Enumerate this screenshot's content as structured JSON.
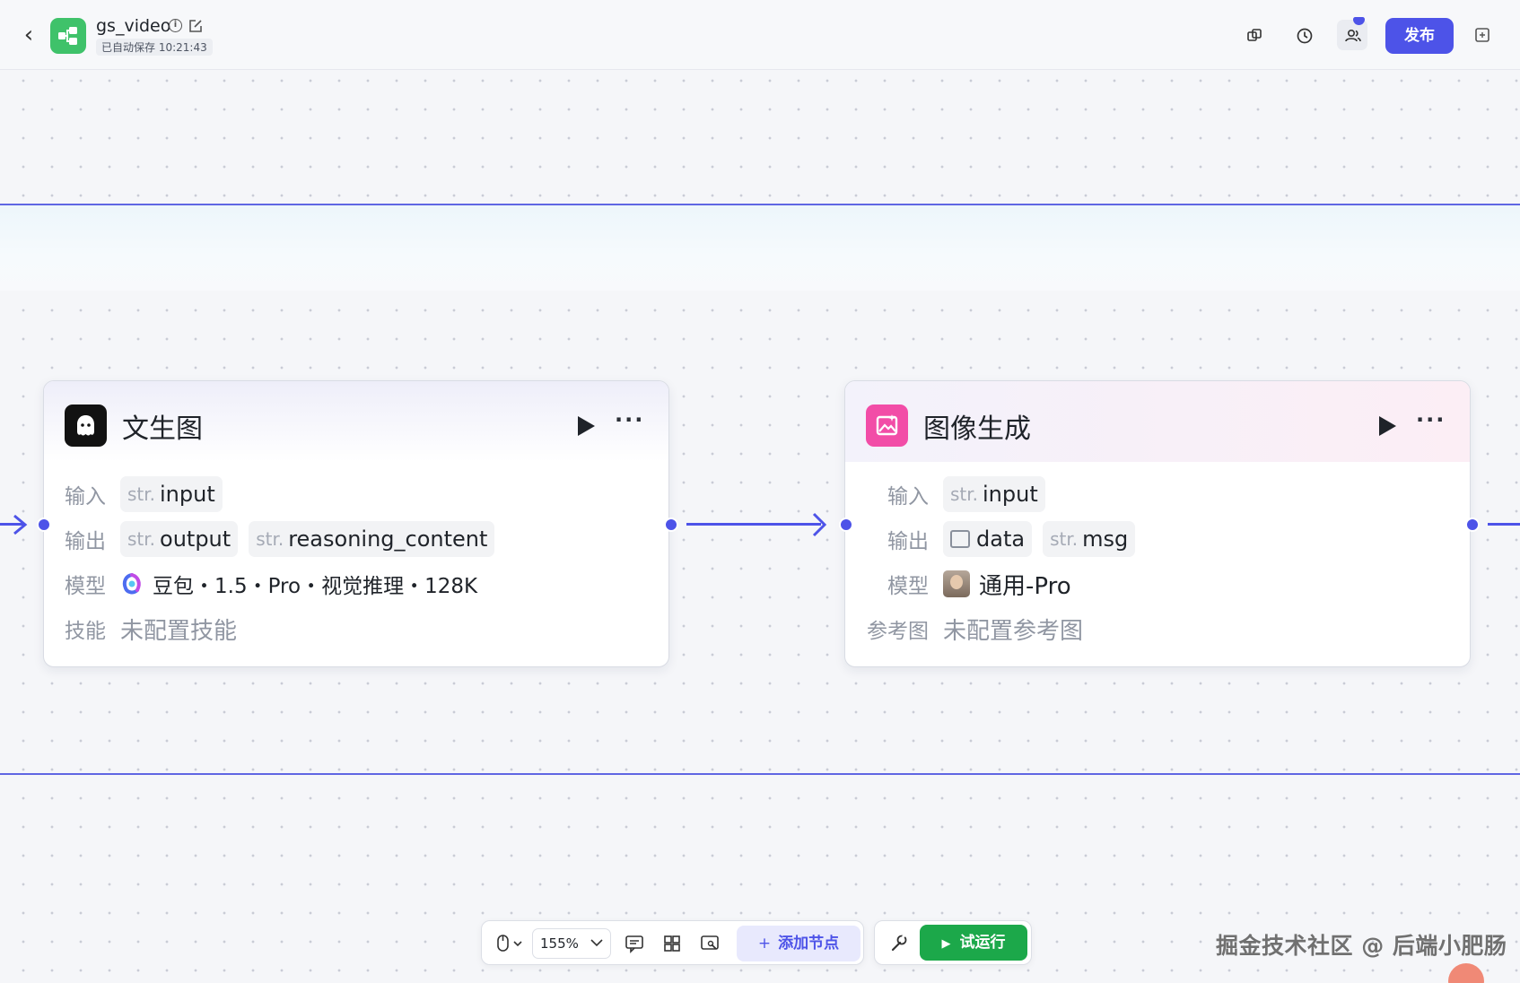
{
  "header": {
    "app_name": "gs_video",
    "autosave": "已自动保存 10:21:43",
    "publish_label": "发布"
  },
  "nodes": [
    {
      "title": "文生图",
      "input_label": "输入",
      "inputs": [
        {
          "type": "str.",
          "name": "input"
        }
      ],
      "output_label": "输出",
      "outputs": [
        {
          "type": "str.",
          "name": "output"
        },
        {
          "type": "str.",
          "name": "reasoning_content"
        }
      ],
      "model_label": "模型",
      "model_value": "豆包・1.5・Pro・视觉推理・128K",
      "extra_label": "技能",
      "extra_value": "未配置技能"
    },
    {
      "title": "图像生成",
      "input_label": "输入",
      "inputs": [
        {
          "type": "str.",
          "name": "input"
        }
      ],
      "output_label": "输出",
      "outputs": [
        {
          "type": "image",
          "name": "data"
        },
        {
          "type": "str.",
          "name": "msg"
        }
      ],
      "model_label": "模型",
      "model_value": "通用-Pro",
      "extra_label": "参考图",
      "extra_value": "未配置参考图"
    }
  ],
  "toolbar": {
    "zoom": "155%",
    "add_node_label": "添加节点",
    "run_label": "试运行"
  },
  "watermark": "掘金技术社区 @ 后端小肥肠",
  "colors": {
    "accent": "#4d53e8",
    "run_green": "#1ca84a",
    "app_icon_green": "#3fc26a",
    "image_node_pink": "#f24da7"
  }
}
